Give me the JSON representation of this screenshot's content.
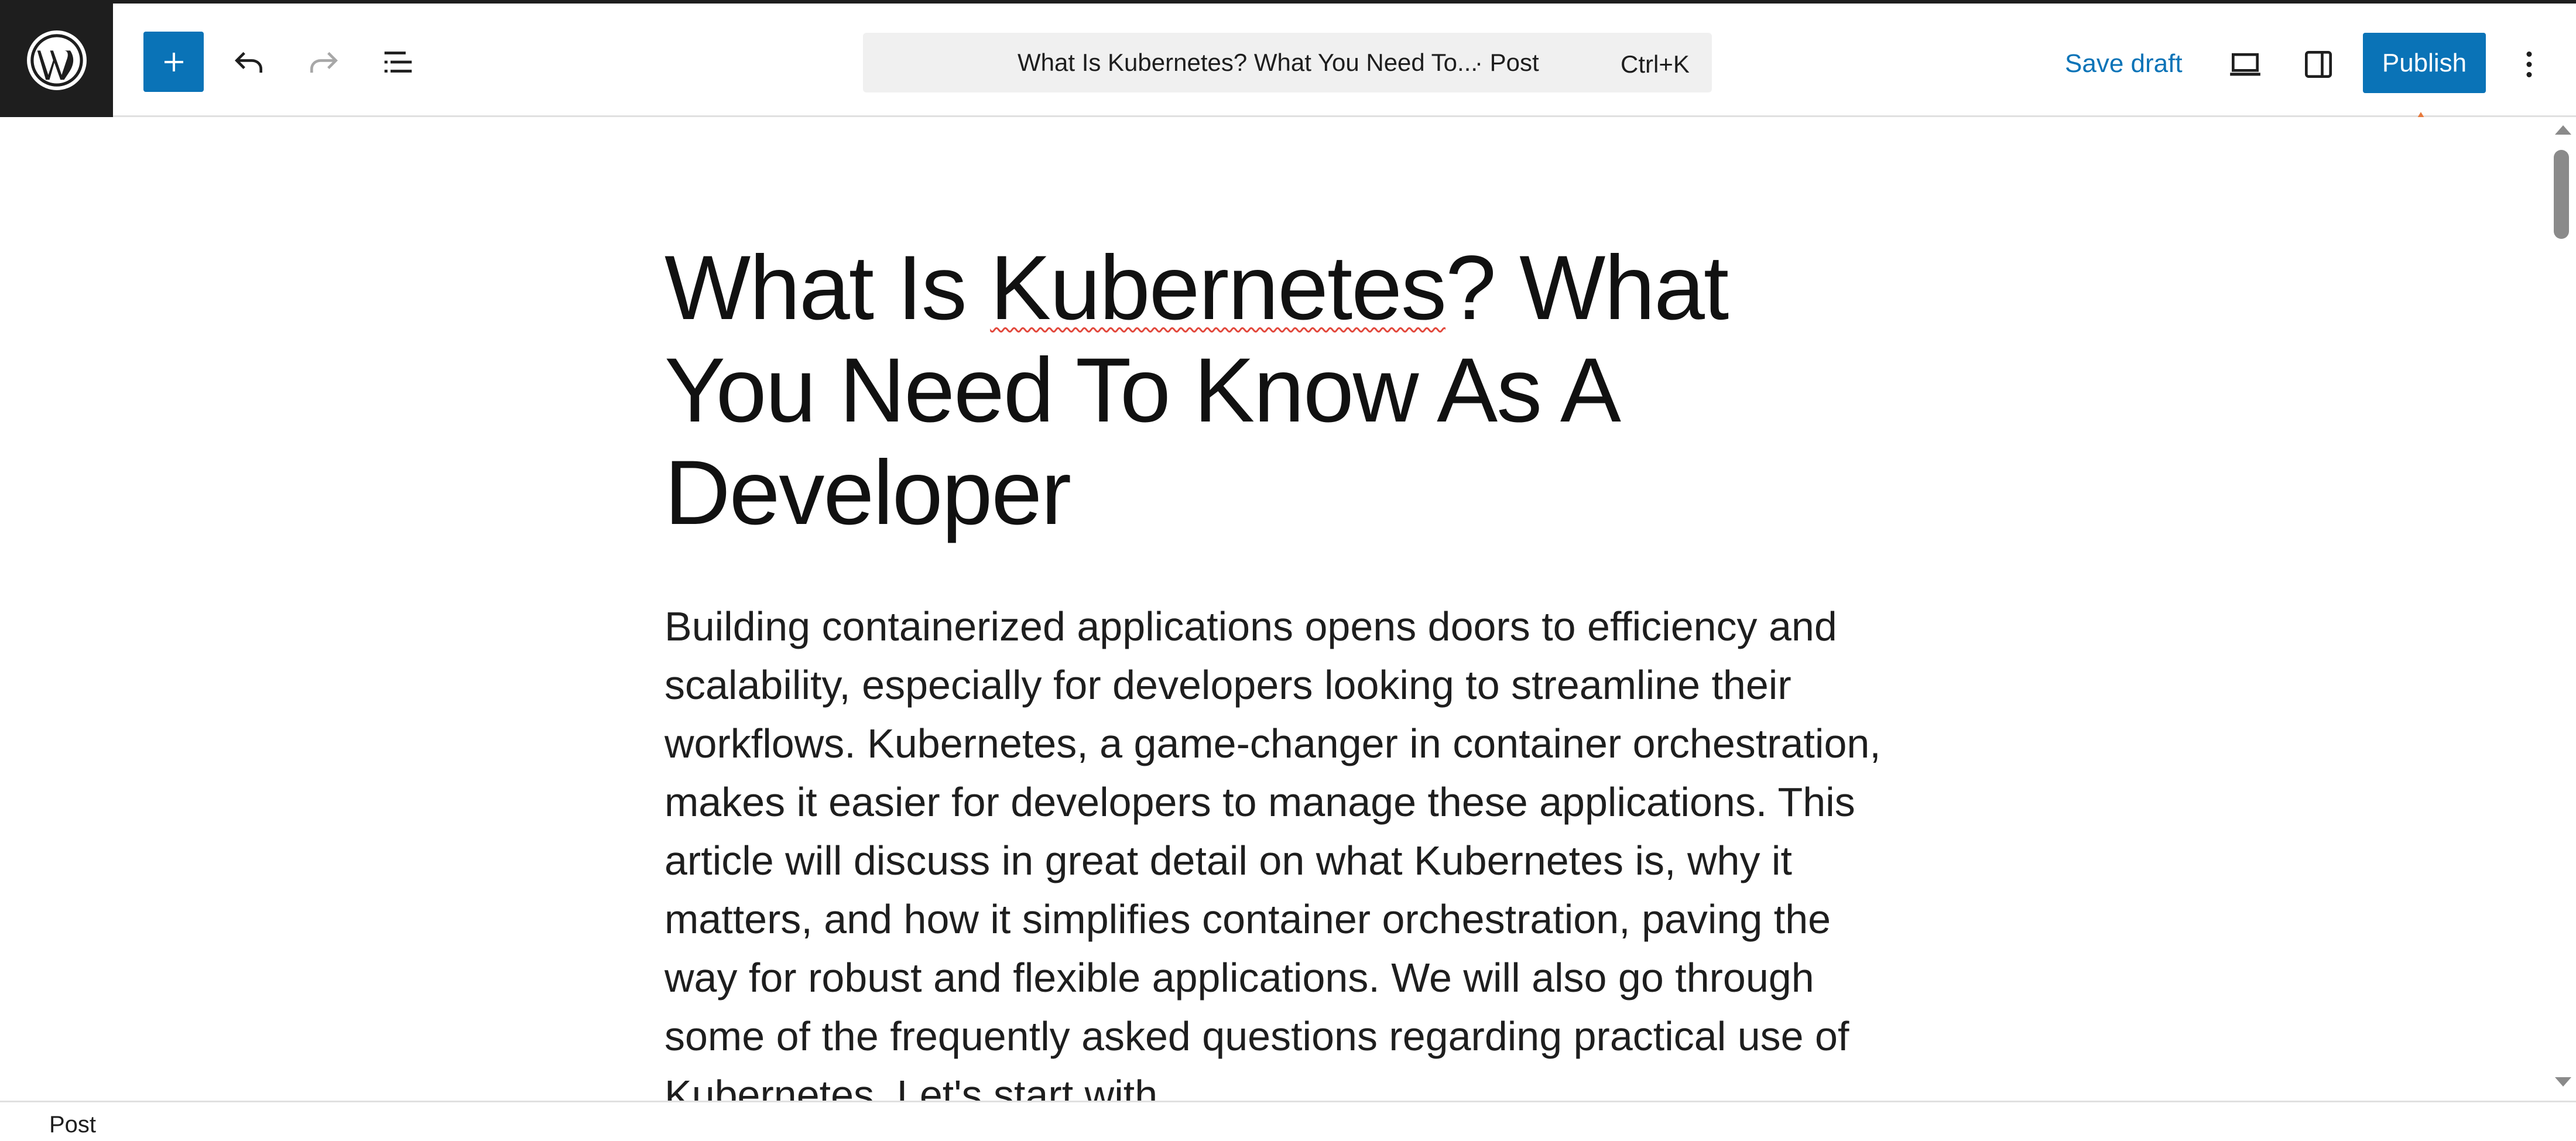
{
  "header": {
    "document_title": "What Is Kubernetes? What You Need To...",
    "document_type": "· Post",
    "command_shortcut": "Ctrl+K",
    "save_draft_label": "Save draft",
    "publish_label": "Publish"
  },
  "post": {
    "title_before": "What Is ",
    "title_misspelled": "Kubernetes",
    "title_after": "? What You Need To Know As A Developer",
    "body": "Building containerized applications opens doors to efficiency and scalability, especially for developers looking to streamline their workflows. Kubernetes, a game-changer in container orchestration, makes it easier for developers to manage these applications. This article will discuss in great detail on what Kubernetes is, why it matters, and how it simplifies container orchestration, paving the way for robust and flexible applications. We will also go through some of the frequently asked questions regarding practical use of Kubernetes. Let's start with"
  },
  "footer": {
    "breadcrumb": "Post"
  },
  "icons": {
    "logo": "wordpress-icon",
    "inserter": "plus-icon",
    "undo": "undo-icon",
    "redo": "redo-icon",
    "outline": "document-overview-icon",
    "preview": "desktop-preview-icon",
    "settings": "sidebar-settings-icon",
    "options": "more-vertical-icon",
    "annotation": "arrow-up-icon"
  },
  "colors": {
    "accent": "#0a73b7",
    "annotation": "#e87a3c",
    "dark": "#1e1e1e"
  }
}
